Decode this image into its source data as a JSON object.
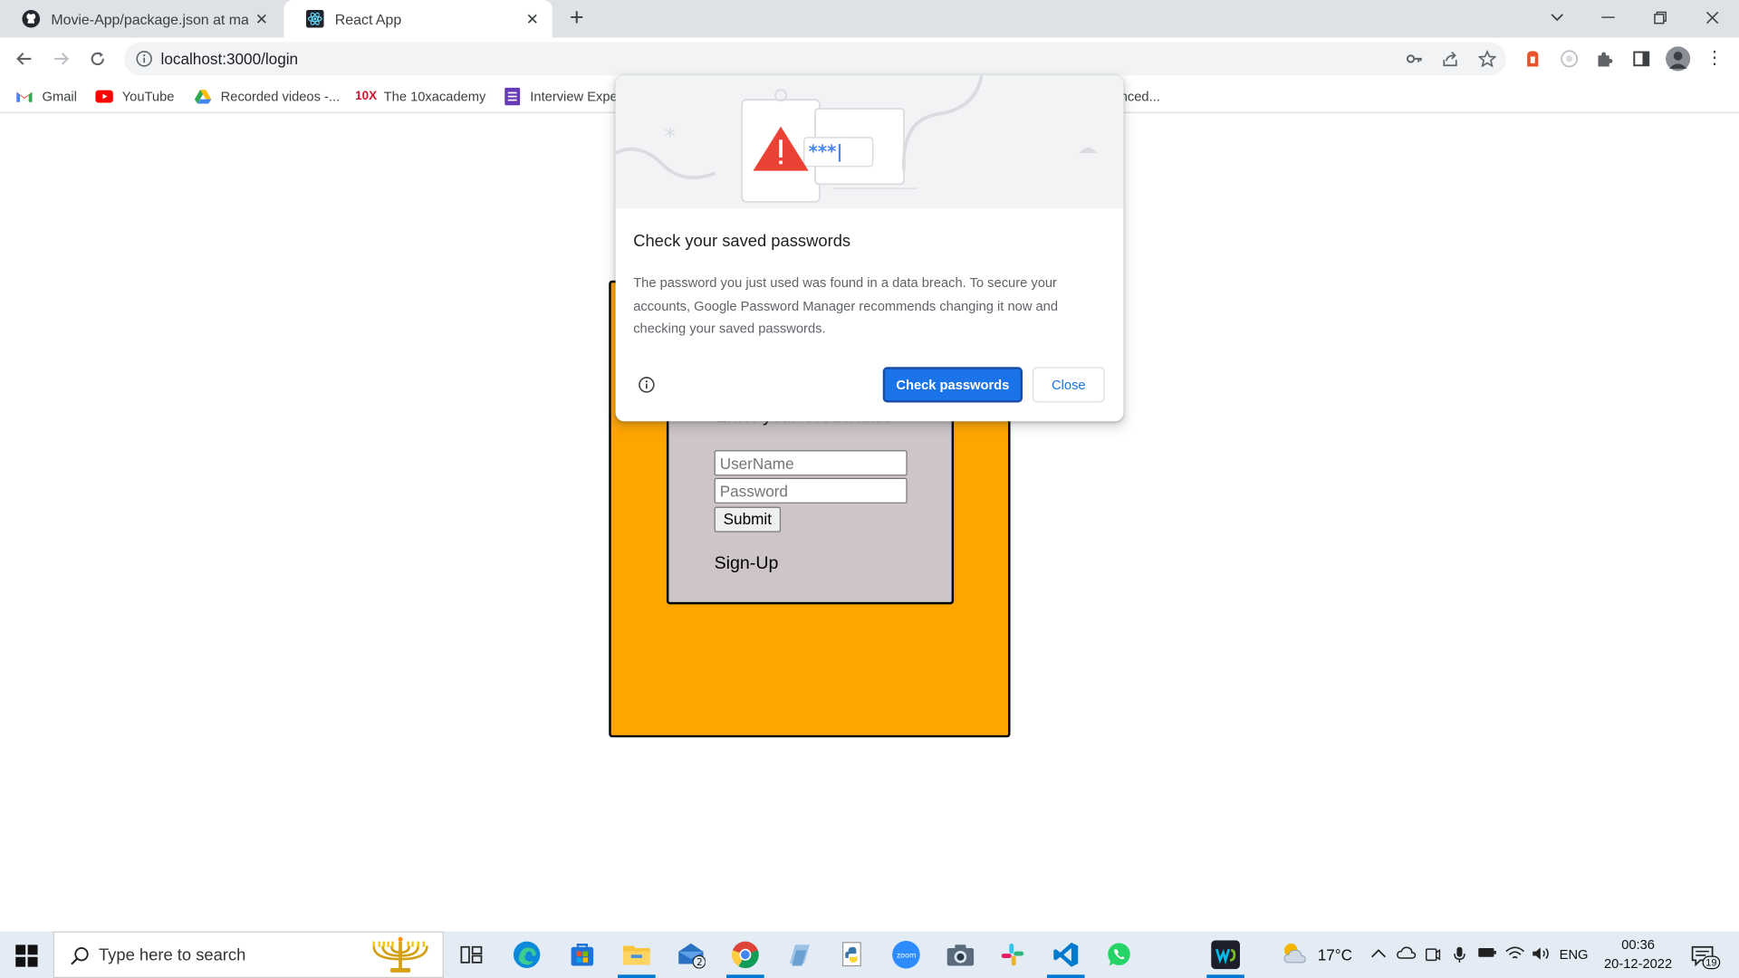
{
  "browser": {
    "tabs": [
      {
        "title": "Movie-App/package.json at main · ",
        "icon": "github-icon"
      },
      {
        "title": "React App",
        "icon": "react-icon",
        "active": true
      }
    ],
    "url": "localhost:3000/login",
    "bookmarks": [
      {
        "label": "Gmail",
        "icon": "gmail-icon"
      },
      {
        "label": "YouTube",
        "icon": "youtube-icon"
      },
      {
        "label": "Recorded videos -...",
        "icon": "google-drive-icon"
      },
      {
        "label": "The 10xacademy",
        "icon": "10x-icon"
      },
      {
        "label": "Interview Expe",
        "icon": "form-icon"
      },
      {
        "label": "nced...",
        "icon": ""
      }
    ]
  },
  "page": {
    "heading": "Enter your Credentials",
    "username_placeholder": "UserName",
    "password_placeholder": "Password",
    "submit_label": "Submit",
    "signup_label": "Sign-Up",
    "colors": {
      "outer_box": "#ffa500",
      "inner_box": "#cec5c6"
    }
  },
  "password_bubble": {
    "title": "Check your saved passwords",
    "body": "The password you just used was found in a data breach. To secure your accounts, Google Password Manager recommends changing it now and checking your saved passwords.",
    "primary_label": "Check passwords",
    "secondary_label": "Close",
    "illustration_text": "***|"
  },
  "taskbar": {
    "search_placeholder": "Type here to search",
    "apps": [
      "task-view-icon",
      "edge-icon",
      "store-icon",
      "file-explorer-icon",
      "mail-icon",
      "chrome-icon",
      "notepad-icon",
      "python-icon",
      "zoom-icon",
      "camera-icon",
      "slack-icon",
      "vscode-icon",
      "whatsapp-icon",
      "webex-icon"
    ],
    "mail_badge": "2",
    "zoom_label": "zoom",
    "temperature": "17°C",
    "language": "ENG",
    "time": "00:36",
    "date": "20-12-2022",
    "notification_count": "19"
  }
}
